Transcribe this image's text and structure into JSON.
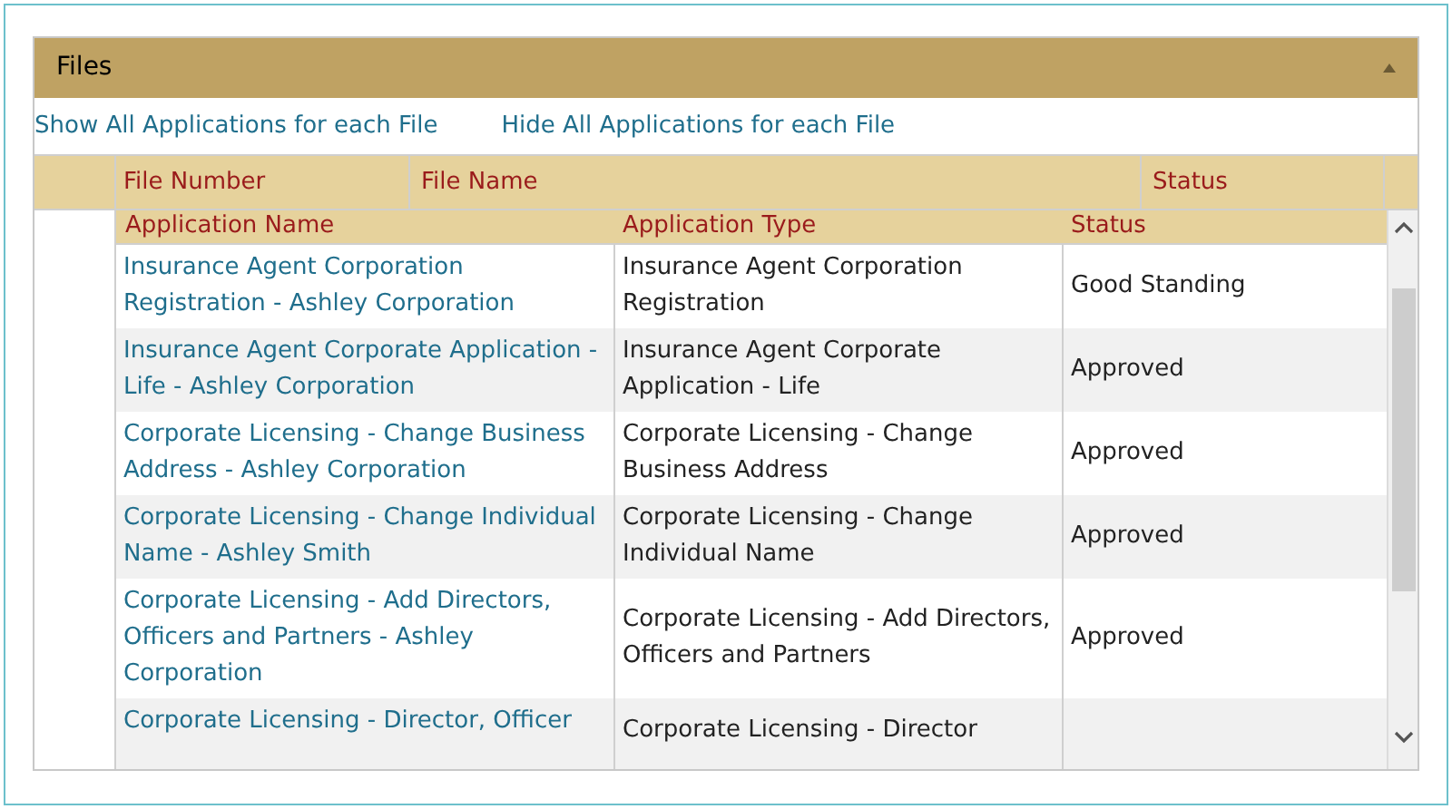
{
  "panel": {
    "title": "Files"
  },
  "links": [
    "Show All Applications for each File",
    "Hide All Applications for each File"
  ],
  "files_table": {
    "columns": [
      "File Number",
      "File Name",
      "Status"
    ]
  },
  "applications_table": {
    "columns": [
      "Application Name",
      "Application Type",
      "Status"
    ],
    "rows": [
      {
        "name": "Insurance Agent Corporation Registration - Ashley Corporation",
        "type": "Insurance Agent Corporation Registration",
        "status": "Good Standing"
      },
      {
        "name": "Insurance Agent Corporate Application - Life - Ashley Corporation",
        "type": "Insurance Agent Corporate Application - Life",
        "status": "Approved"
      },
      {
        "name": "Corporate Licensing - Change Business Address - Ashley Corporation",
        "type": "Corporate Licensing - Change Business Address",
        "status": "Approved"
      },
      {
        "name": "Corporate Licensing - Change Individual Name - Ashley Smith",
        "type": "Corporate Licensing - Change Individual Name",
        "status": "Approved"
      },
      {
        "name": "Corporate Licensing - Add Directors, Officers and Partners - Ashley Corporation",
        "type": "Corporate Licensing - Add Directors, Officers and Partners",
        "status": "Approved"
      },
      {
        "name": "Corporate Licensing - Director, Officer",
        "type": "Corporate Licensing - Director"
      }
    ]
  }
}
